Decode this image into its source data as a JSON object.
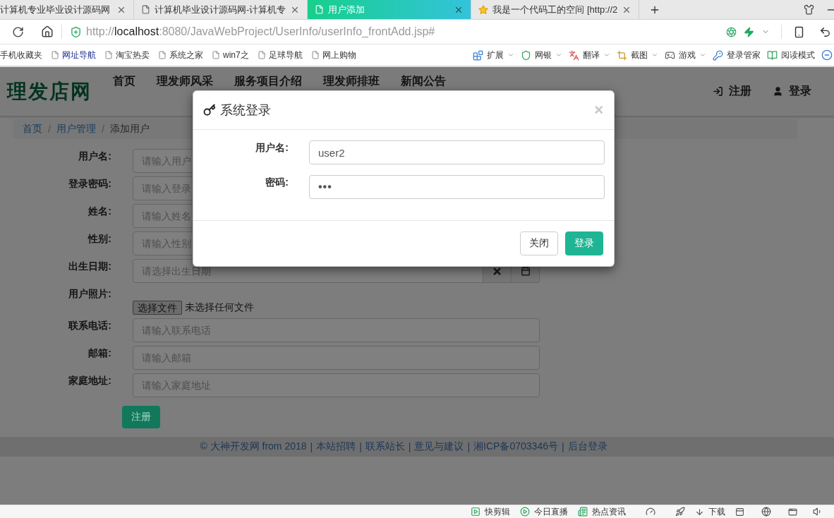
{
  "browser": {
    "tabs": [
      {
        "title": "计算机专业毕业设计源码网",
        "kind": "plain",
        "selected": false
      },
      {
        "title": "计算机毕业设计源码网-计算机专",
        "kind": "page",
        "selected": false
      },
      {
        "title": "用户添加",
        "kind": "page",
        "selected": true
      },
      {
        "title": "我是一个代码工的空间 [http://2",
        "kind": "starred",
        "selected": false
      }
    ],
    "address": {
      "scheme": "http://",
      "host": "localhost",
      "rest": ":8080/JavaWebProject/UserInfo/userInfo_frontAdd.jsp#"
    },
    "bookmarks": [
      {
        "label": "手机收藏夹",
        "kind": "plain"
      },
      {
        "label": "网址导航",
        "kind": "featured"
      },
      {
        "label": "淘宝热卖",
        "kind": "page"
      },
      {
        "label": "系统之家",
        "kind": "page"
      },
      {
        "label": "win7之",
        "kind": "page"
      },
      {
        "label": "足球导航",
        "kind": "page"
      },
      {
        "label": "网上购物",
        "kind": "page"
      }
    ],
    "tools": [
      {
        "label": "扩展",
        "kind": "extensions",
        "dropdown": true
      },
      {
        "label": "网银",
        "kind": "banking",
        "dropdown": true
      },
      {
        "label": "翻译",
        "kind": "translate",
        "dropdown": true
      },
      {
        "label": "截图",
        "kind": "capture",
        "dropdown": true
      },
      {
        "label": "游戏",
        "kind": "games",
        "dropdown": true
      },
      {
        "label": "登录管家",
        "kind": "login",
        "dropdown": false
      },
      {
        "label": "阅读模式",
        "kind": "reading",
        "dropdown": false
      }
    ]
  },
  "site": {
    "logo": "理发店网",
    "nav": [
      "首页",
      "理发师风采",
      "服务项目介绍",
      "理发师排班",
      "新闻公告"
    ],
    "actions": [
      {
        "label": "注册",
        "kind": "signup"
      },
      {
        "label": "登录",
        "kind": "login"
      }
    ]
  },
  "breadcrumb": {
    "separator": "/",
    "items": [
      {
        "label": "首页",
        "current": false
      },
      {
        "label": "用户管理",
        "current": false
      },
      {
        "label": "添加用户",
        "current": true
      }
    ]
  },
  "form": {
    "fields": [
      {
        "label": "用户名:",
        "kind": "text",
        "placeholder": "请输入用户"
      },
      {
        "label": "登录密码:",
        "kind": "text",
        "placeholder": "请输入登录"
      },
      {
        "label": "姓名:",
        "kind": "text",
        "placeholder": "请输入姓名"
      },
      {
        "label": "性别:",
        "kind": "text",
        "placeholder": "请输入性别"
      },
      {
        "label": "出生日期:",
        "kind": "date",
        "placeholder": "请选择出生日期"
      },
      {
        "label": "用户照片:",
        "kind": "file",
        "button": "选择文件",
        "status": "未选择任何文件"
      },
      {
        "label": "联系电话:",
        "kind": "text",
        "placeholder": "请输入联系电话"
      },
      {
        "label": "邮箱:",
        "kind": "text",
        "placeholder": "请输入邮箱"
      },
      {
        "label": "家庭地址:",
        "kind": "text",
        "placeholder": "请输入家庭地址"
      }
    ],
    "submit": "注册"
  },
  "footer": {
    "copyright": "© 大神开发网 from 2018",
    "separator": "|",
    "links": [
      "本站招聘",
      "联系站长",
      "意见与建议",
      "湘ICP备0703346号",
      "后台登录"
    ]
  },
  "modal": {
    "title": "系统登录",
    "close": "×",
    "fields": [
      {
        "label": "用户名:",
        "kind": "text",
        "value": "user2"
      },
      {
        "label": "密码:",
        "kind": "password",
        "value": "•••"
      }
    ],
    "buttons": [
      {
        "label": "关闭",
        "kind": "default"
      },
      {
        "label": "登录",
        "kind": "primary"
      }
    ]
  },
  "status_bar": {
    "apps": [
      {
        "label": "快剪辑",
        "kind": "clip"
      },
      {
        "label": "今日直播",
        "kind": "live"
      },
      {
        "label": "热点资讯",
        "kind": "news"
      }
    ],
    "download": "下载"
  }
}
